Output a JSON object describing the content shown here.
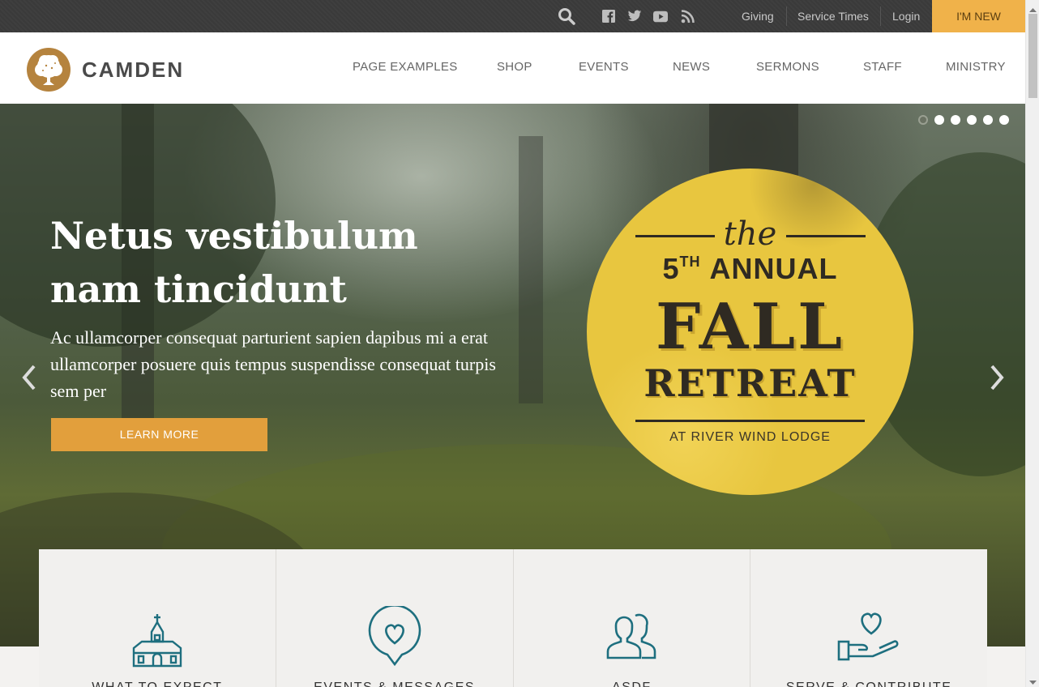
{
  "topbar": {
    "social_icons": [
      "facebook-icon",
      "twitter-icon",
      "youtube-icon",
      "rss-icon"
    ],
    "links": [
      "Giving",
      "Service Times",
      "Login"
    ],
    "cta": "I'M NEW"
  },
  "header": {
    "logo_text": "CAMDEN",
    "nav": [
      "PAGE EXAMPLES",
      "SHOP",
      "EVENTS",
      "NEWS",
      "SERMONS",
      "STAFF",
      "MINISTRY"
    ]
  },
  "hero": {
    "title_line1": "Netus vestibulum",
    "title_line2": "nam tincidunt",
    "subtitle": "Ac ullamcorper consequat parturient sapien dapibus mi a erat ullamcorper posuere quis tempus suspendisse consequat turpis sem per",
    "button": "LEARN MORE",
    "slide_count": 6,
    "active_slide": 1
  },
  "badge": {
    "the": "the",
    "annual_num": "5",
    "annual_sup": "TH",
    "annual_word": "ANNUAL",
    "fall": "FALL",
    "retreat": "RETREAT",
    "lodge": "AT RIVER WIND LODGE"
  },
  "features": [
    {
      "label": "WHAT TO EXPECT",
      "icon": "church-icon"
    },
    {
      "label": "EVENTS & MESSAGES",
      "icon": "heart-chat-icon"
    },
    {
      "label": "ASDF",
      "icon": "people-icon"
    },
    {
      "label": "SERVE & CONTRIBUTE",
      "icon": "heart-hand-icon"
    }
  ],
  "colors": {
    "accent": "#f0b24a",
    "button": "#e29f3c",
    "badge": "#e8c63f",
    "icon_teal": "#1e6f7f",
    "topbar": "#3a3a3a"
  }
}
